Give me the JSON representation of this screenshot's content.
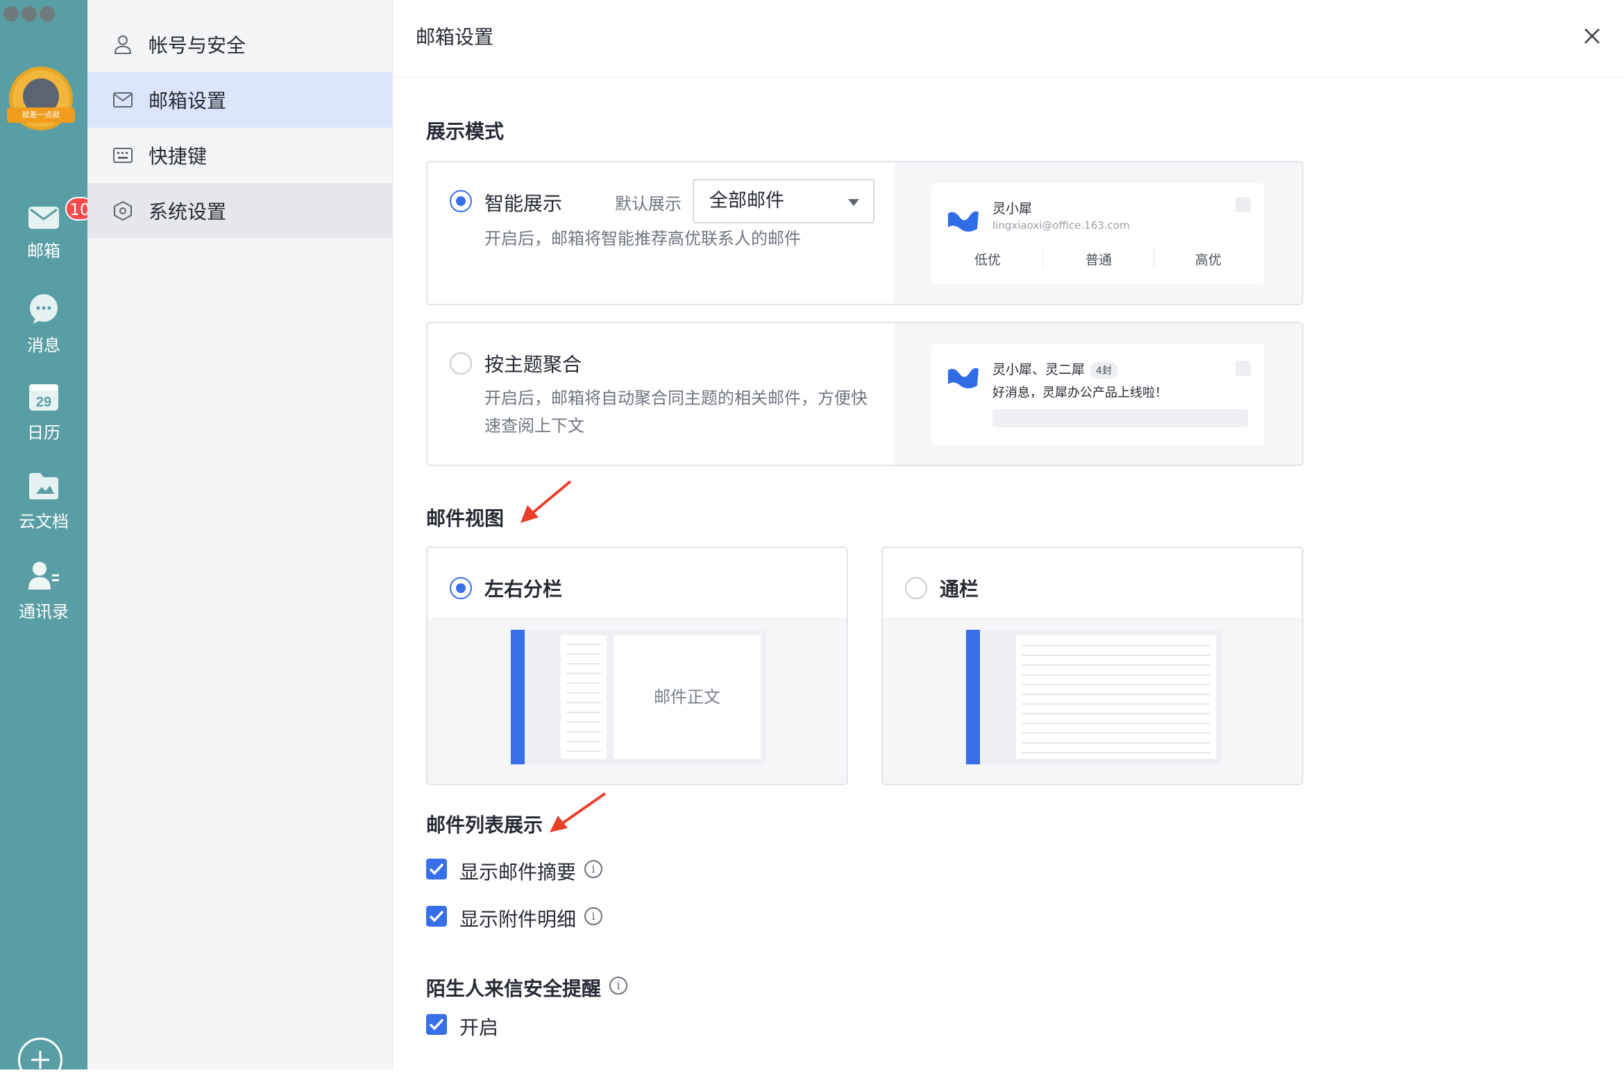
{
  "rail": {
    "avatar_ribbon": "就差一点就",
    "items": [
      {
        "label": "邮箱",
        "icon": "mail-icon",
        "badge": "10"
      },
      {
        "label": "消息",
        "icon": "chat-icon"
      },
      {
        "label": "日历",
        "icon": "calendar-icon",
        "day": "29"
      },
      {
        "label": "云文档",
        "icon": "folder-icon"
      },
      {
        "label": "通讯录",
        "icon": "contacts-icon"
      }
    ]
  },
  "settings_nav": {
    "items": [
      {
        "label": "帐号与安全",
        "icon": "user-icon"
      },
      {
        "label": "邮箱设置",
        "icon": "mail-icon",
        "active": true
      },
      {
        "label": "快捷键",
        "icon": "keyboard-icon"
      },
      {
        "label": "系统设置",
        "icon": "hexagon-settings-icon"
      }
    ]
  },
  "header": {
    "title": "邮箱设置"
  },
  "display_mode": {
    "title": "展示模式",
    "smart": {
      "title": "智能展示",
      "default_label": "默认展示",
      "select_value": "全部邮件",
      "desc": "开启后，邮箱将智能推荐高优联系人的邮件",
      "preview": {
        "name": "灵小犀",
        "email": "lingxiaoxi@office.163.com",
        "priorities": [
          "低优",
          "普通",
          "高优"
        ]
      }
    },
    "thread": {
      "title": "按主题聚合",
      "desc_line1": "开启后，邮箱将自动聚合同主题的相关邮件，方便快",
      "desc_line2": "速查阅上下文",
      "preview": {
        "names": "灵小犀、灵二犀",
        "count": "4封",
        "subject": "好消息，灵犀办公产品上线啦！"
      }
    }
  },
  "mail_view": {
    "title": "邮件视图",
    "split": {
      "title": "左右分栏",
      "body_label": "邮件正文"
    },
    "full": {
      "title": "通栏"
    }
  },
  "list_display": {
    "title": "邮件列表展示",
    "options": [
      {
        "label": "显示邮件摘要",
        "checked": true
      },
      {
        "label": "显示附件明细",
        "checked": true
      }
    ]
  },
  "stranger": {
    "title": "陌生人来信安全提醒",
    "option": {
      "label": "开启",
      "checked": true
    }
  },
  "colors": {
    "accent": "#386ee7",
    "rail": "#5a9ea5",
    "arrow": "#e8402a"
  }
}
